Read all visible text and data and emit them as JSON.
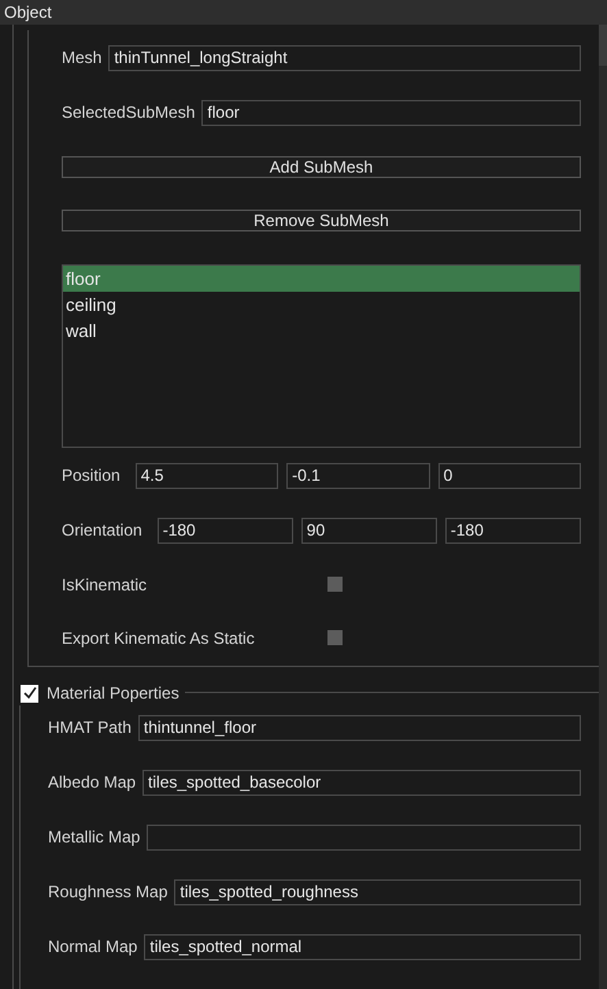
{
  "window": {
    "title": "Object"
  },
  "object_rows": [
    {
      "kind": "text_field",
      "label": "Mesh",
      "value": "thinTunnel_longStraight"
    },
    {
      "kind": "text_field",
      "label": "SelectedSubMesh",
      "value": "floor"
    },
    {
      "kind": "button",
      "label": "Add SubMesh"
    },
    {
      "kind": "button",
      "label": "Remove SubMesh"
    },
    {
      "kind": "listbox",
      "items": [
        {
          "label": "floor",
          "selected": true
        },
        {
          "label": "ceiling",
          "selected": false
        },
        {
          "label": "wall",
          "selected": false
        }
      ]
    },
    {
      "kind": "vector3",
      "label": "Position",
      "values": [
        "4.5",
        "-0.1",
        "0"
      ]
    },
    {
      "kind": "vector3",
      "label": "Orientation",
      "values": [
        "-180",
        "90",
        "-180"
      ]
    },
    {
      "kind": "checkbox",
      "label": "IsKinematic",
      "checked": false
    },
    {
      "kind": "checkbox",
      "label": "Export Kinematic As Static",
      "checked": false
    }
  ],
  "material": {
    "label": "Material Poperties",
    "checked": true,
    "rows": [
      {
        "kind": "text_field",
        "label": "HMAT Path",
        "value": "thintunnel_floor"
      },
      {
        "kind": "text_field",
        "label": "Albedo Map",
        "value": "tiles_spotted_basecolor"
      },
      {
        "kind": "text_field",
        "label": "Metallic Map"
      },
      {
        "kind": "text_field",
        "label": "Roughness Map",
        "value": "tiles_spotted_roughness"
      },
      {
        "kind": "text_field",
        "label": "Normal Map",
        "value": "tiles_spotted_normal"
      }
    ]
  }
}
